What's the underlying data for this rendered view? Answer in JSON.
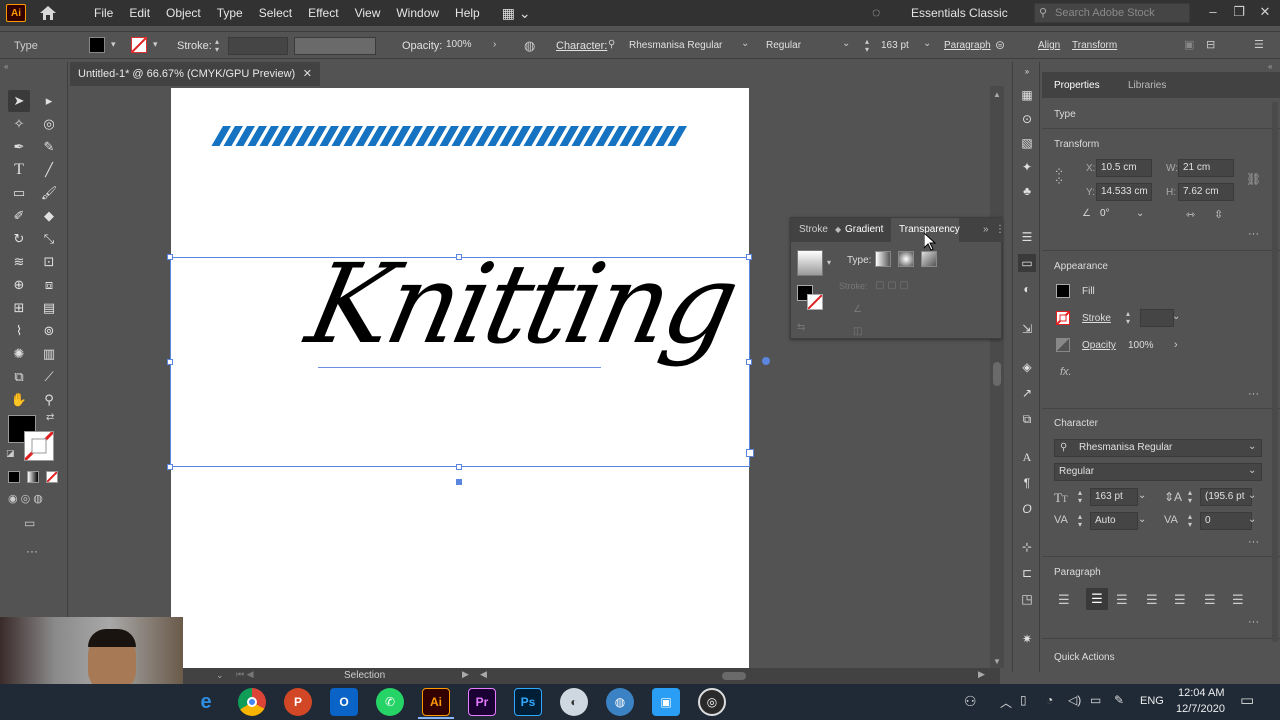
{
  "menu": {
    "app_logo": "Ai",
    "items": [
      "File",
      "Edit",
      "Object",
      "Type",
      "Select",
      "Effect",
      "View",
      "Window",
      "Help"
    ],
    "workspace": "Essentials Classic",
    "search_placeholder": "Search Adobe Stock"
  },
  "control_bar": {
    "tool_name": "Type",
    "stroke_label": "Stroke:",
    "opacity_label": "Opacity:",
    "opacity_value": "100%",
    "character_label": "Character:",
    "font_name": "Rhesmanisa Regular",
    "font_style": "Regular",
    "font_size": "163 pt",
    "paragraph_label": "Paragraph",
    "align_label": "Align",
    "transform_label": "Transform"
  },
  "document": {
    "tab_title": "Untitled-1* @ 66.67% (CMYK/GPU Preview)",
    "artwork_text": "Knitting",
    "accent_color": "#1673c2"
  },
  "gradient_panel": {
    "tabs": [
      "Stroke",
      "Gradient",
      "Transparency"
    ],
    "type_label": "Type:",
    "stroke_label": "Stroke:"
  },
  "properties": {
    "tabs": [
      "Properties",
      "Libraries"
    ],
    "object_type": "Type",
    "transform_heading": "Transform",
    "x_label": "X:",
    "x_value": "10.5 cm",
    "y_label": "Y:",
    "y_value": "14.533 cm",
    "w_label": "W:",
    "w_value": "21 cm",
    "h_label": "H:",
    "h_value": "7.62 cm",
    "rotation_value": "0°",
    "appearance_heading": "Appearance",
    "fill_label": "Fill",
    "stroke_label": "Stroke",
    "opacity_label": "Opacity",
    "opacity_value": "100%",
    "fx_label": "fx.",
    "character_heading": "Character",
    "font_name": "Rhesmanisa Regular",
    "font_style": "Regular",
    "font_size": "163 pt",
    "leading": "(195.6 pt",
    "kerning": "Auto",
    "tracking": "0",
    "paragraph_heading": "Paragraph",
    "quick_actions_heading": "Quick Actions"
  },
  "status_bar": {
    "tool": "Selection"
  },
  "taskbar": {
    "language": "ENG",
    "time": "12:04 AM",
    "date": "12/7/2020",
    "apps": [
      "Edge",
      "Chrome",
      "PowerPoint",
      "Outlook",
      "WhatsApp",
      "Illustrator",
      "Premiere",
      "Photoshop",
      "App",
      "App",
      "Photos",
      "OBS"
    ]
  }
}
